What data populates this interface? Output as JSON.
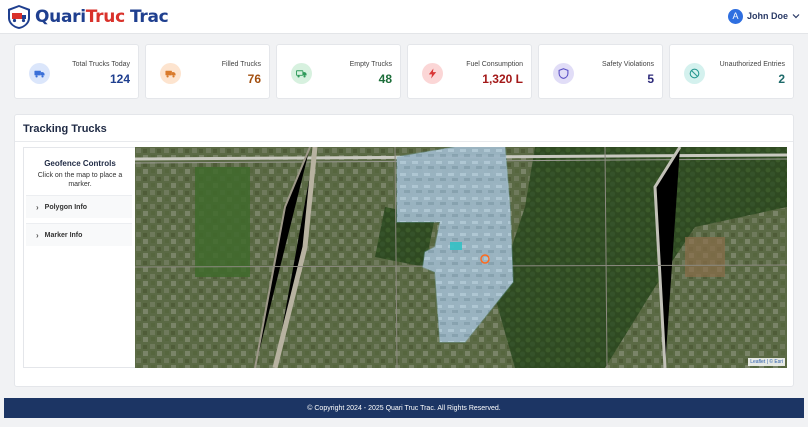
{
  "brand": {
    "part1": "Quari",
    "part2": "Truc",
    "part3": "Trac"
  },
  "user": {
    "initial": "A",
    "name": "John Doe"
  },
  "cards": [
    {
      "label": "Total Trucks Today",
      "value": "124",
      "icon": "truck-icon",
      "color": "#1f3f8f",
      "bg": "#dbe6fb",
      "icon_color": "#3a6fd8"
    },
    {
      "label": "Filled Trucks",
      "value": "76",
      "icon": "truck-filled-icon",
      "color": "#a35010",
      "bg": "#fde4cf",
      "icon_color": "#d97a2b"
    },
    {
      "label": "Empty Trucks",
      "value": "48",
      "icon": "truck-empty-icon",
      "color": "#1d6e3a",
      "bg": "#d7f1df",
      "icon_color": "#2f9a5a"
    },
    {
      "label": "Fuel Consumption",
      "value": "1,320 L",
      "icon": "bolt-icon",
      "color": "#a31818",
      "bg": "#fbd6d6",
      "icon_color": "#d93636"
    },
    {
      "label": "Safety Violations",
      "value": "5",
      "icon": "shield-icon",
      "color": "#2d2a7a",
      "bg": "#e1ddf7",
      "icon_color": "#5a4fc4"
    },
    {
      "label": "Unauthorized Entries",
      "value": "2",
      "icon": "ban-icon",
      "color": "#1d6a6a",
      "bg": "#d4f1ee",
      "icon_color": "#2a9a92"
    }
  ],
  "tracking": {
    "title": "Tracking Trucks",
    "geofence": {
      "title": "Geofence Controls",
      "subtitle": "Click on the map to place a marker.",
      "sections": [
        "Polygon Info",
        "Marker Info"
      ]
    },
    "attribution": "Leaflet | © Esri"
  },
  "footer": {
    "text": "© Copyright 2024 - 2025 Quari Truc Trac. All Rights Reserved."
  }
}
